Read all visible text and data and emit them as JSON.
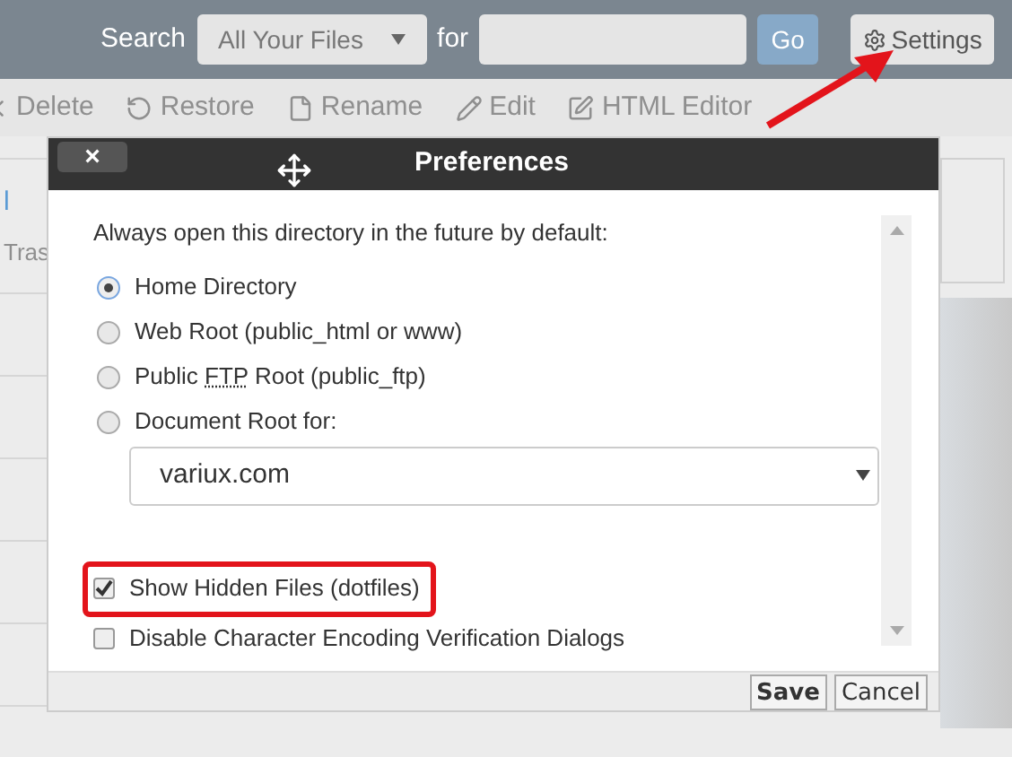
{
  "search": {
    "label": "Search",
    "scope": "All Your Files",
    "for_label": "for",
    "go": "Go",
    "settings": "Settings"
  },
  "toolbar": [
    {
      "label": "Delete",
      "disabled": true
    },
    {
      "label": "Restore",
      "disabled": true
    },
    {
      "label": "Rename",
      "disabled": true
    },
    {
      "label": "Edit",
      "disabled": true
    },
    {
      "label": "HTML Editor",
      "disabled": true
    }
  ],
  "left_panel": {
    "link": "l",
    "text": "Tras"
  },
  "dialog": {
    "title": "Preferences",
    "close": "×",
    "prompt": "Always open this directory in the future by default:",
    "options": [
      {
        "parts": [
          {
            "text": "Home Directory"
          }
        ],
        "selected": true
      },
      {
        "parts": [
          {
            "text": "Web Root (public_html or www)"
          }
        ],
        "selected": false
      },
      {
        "parts": [
          {
            "text": "Public "
          },
          {
            "text": "FTP",
            "abbr": true
          },
          {
            "text": " Root (public_ftp)"
          }
        ],
        "selected": false
      },
      {
        "parts": [
          {
            "text": "Document Root for:"
          }
        ],
        "selected": false
      }
    ],
    "document_root": "variux.com",
    "checkboxes": [
      {
        "label": "Show Hidden Files (dotfiles)",
        "checked": true,
        "highlighted": true
      },
      {
        "label": "Disable Character Encoding Verification Dialogs",
        "checked": false,
        "highlighted": false
      }
    ],
    "buttons": [
      {
        "label": "Save",
        "bold": true
      },
      {
        "label": "Cancel",
        "bold": false
      }
    ]
  }
}
